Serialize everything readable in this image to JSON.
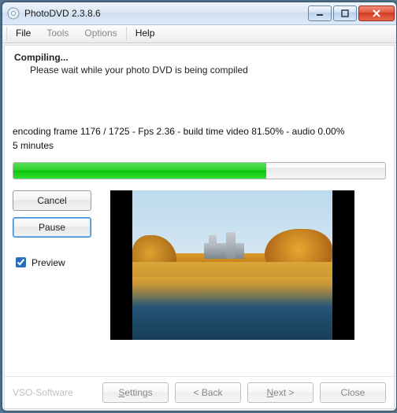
{
  "window": {
    "title": "PhotoDVD 2.3.8.6"
  },
  "menu": {
    "file": "File",
    "tools": "Tools",
    "options": "Options",
    "help": "Help"
  },
  "compile": {
    "heading": "Compiling...",
    "subtext": "Please wait while your photo DVD is being compiled",
    "status": "encoding frame 1176 / 1725  - Fps 2.36   - build time video 81.50% - audio 0.00%",
    "time": "5 minutes",
    "progress_percent": 68
  },
  "buttons": {
    "cancel": "Cancel",
    "pause": "Pause"
  },
  "preview": {
    "label": "Preview",
    "checked": true
  },
  "footer": {
    "brand": "VSO-Software",
    "settings": "Settings",
    "back": "< Back",
    "next": "Next >",
    "close": "Close"
  }
}
